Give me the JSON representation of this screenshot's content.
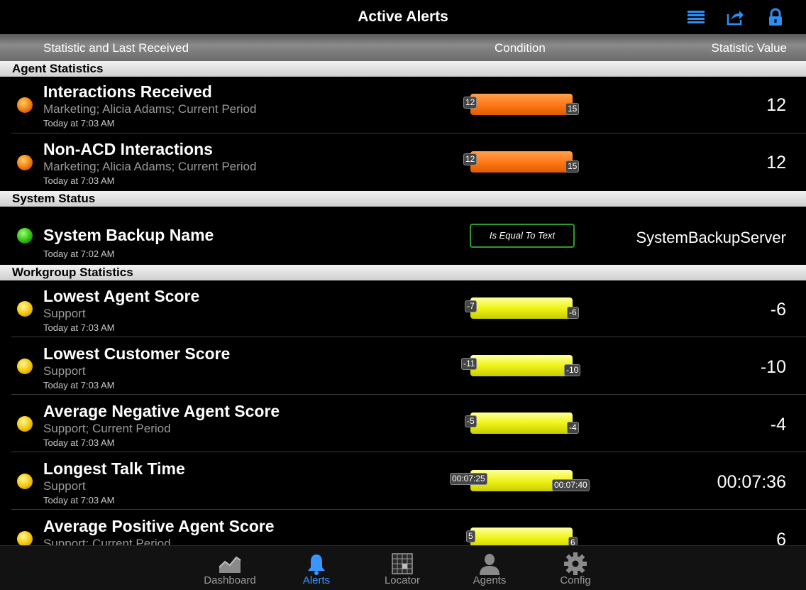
{
  "nav": {
    "title": "Active Alerts",
    "icons": [
      "list-icon",
      "share-icon",
      "lock-icon"
    ]
  },
  "columns": {
    "statistic": "Statistic and Last Received",
    "condition": "Condition",
    "value": "Statistic Value"
  },
  "sections": {
    "agent": "Agent Statistics",
    "system": "System Status",
    "workgroup": "Workgroup Statistics"
  },
  "rows": [
    {
      "name": "Interactions Received",
      "sub": "Marketing; Alicia Adams; Current Period",
      "time": "Today at 7:03 AM",
      "min": "12",
      "max": "15",
      "value": "12"
    },
    {
      "name": "Non-ACD Interactions",
      "sub": "Marketing; Alicia Adams; Current Period",
      "time": "Today at 7:03 AM",
      "min": "12",
      "max": "15",
      "value": "12"
    },
    {
      "name": "System Backup Name",
      "time": "Today at 7:02 AM",
      "condition": "Is Equal To Text",
      "value": "SystemBackupServer"
    },
    {
      "name": "Lowest Agent Score",
      "sub": "Support",
      "time": "Today at 7:03 AM",
      "min": "-7",
      "max": "-6",
      "value": "-6"
    },
    {
      "name": "Lowest Customer Score",
      "sub": "Support",
      "time": "Today at 7:03 AM",
      "min": "-11",
      "max": "-10",
      "value": "-10"
    },
    {
      "name": "Average Negative Agent Score",
      "sub": "Support; Current Period",
      "time": "Today at 7:03 AM",
      "min": "-5",
      "max": "-4",
      "value": "-4"
    },
    {
      "name": "Longest Talk Time",
      "sub": "Support",
      "time": "Today at 7:03 AM",
      "min": "00:07:25",
      "max": "00:07:40",
      "value": "00:07:36"
    },
    {
      "name": "Average Positive Agent Score",
      "sub": "Support; Current Period",
      "min": "5",
      "max": "6",
      "value": "6"
    }
  ],
  "status_colors": {
    "orange": "#f07a10",
    "green": "#2fbe12",
    "yellow": "#f4c400"
  },
  "tabs": [
    {
      "label": "Dashboard",
      "icon": "chart-icon"
    },
    {
      "label": "Alerts",
      "icon": "bell-icon",
      "active": true
    },
    {
      "label": "Locator",
      "icon": "grid-icon"
    },
    {
      "label": "Agents",
      "icon": "person-icon"
    },
    {
      "label": "Config",
      "icon": "gear-icon"
    }
  ]
}
